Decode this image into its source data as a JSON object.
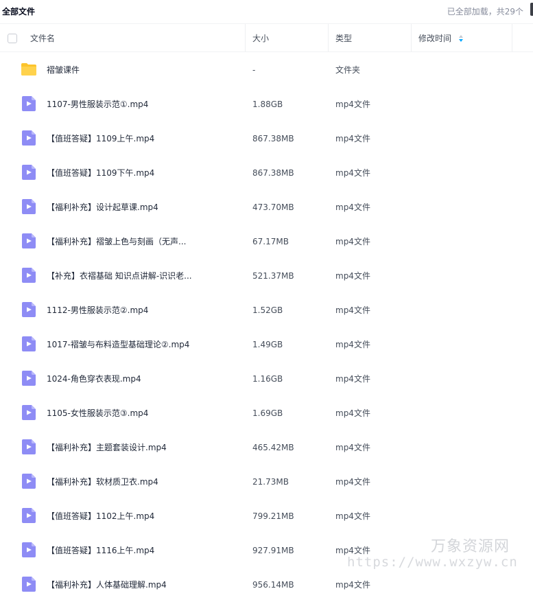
{
  "topbar": {
    "breadcrumb": "全部文件",
    "load_status": "已全部加载，共29个"
  },
  "header": {
    "name": "文件名",
    "size": "大小",
    "type": "类型",
    "modified": "修改时间"
  },
  "colors": {
    "folder": "#fcc42c",
    "video": "#8e8cf5",
    "divider": "#f1f2f4",
    "sort_active": "#06a7ff"
  },
  "files": [
    {
      "name": "褶皱课件",
      "size": "-",
      "type": "文件夹",
      "icon": "folder-icon"
    },
    {
      "name": "1107-男性服装示范①.mp4",
      "size": "1.88GB",
      "type": "mp4文件",
      "icon": "video-icon"
    },
    {
      "name": "【值班答疑】1109上午.mp4",
      "size": "867.38MB",
      "type": "mp4文件",
      "icon": "video-icon"
    },
    {
      "name": "【值班答疑】1109下午.mp4",
      "size": "867.38MB",
      "type": "mp4文件",
      "icon": "video-icon"
    },
    {
      "name": "【福利补充】设计起草课.mp4",
      "size": "473.70MB",
      "type": "mp4文件",
      "icon": "video-icon"
    },
    {
      "name": "【福利补充】褶皱上色与刻画（无声...",
      "size": "67.17MB",
      "type": "mp4文件",
      "icon": "video-icon"
    },
    {
      "name": "【补充】衣褶基础 知识点讲解-识识老...",
      "size": "521.37MB",
      "type": "mp4文件",
      "icon": "video-icon"
    },
    {
      "name": "1112-男性服装示范②.mp4",
      "size": "1.52GB",
      "type": "mp4文件",
      "icon": "video-icon"
    },
    {
      "name": "1017-褶皱与布料造型基础理论②.mp4",
      "size": "1.49GB",
      "type": "mp4文件",
      "icon": "video-icon"
    },
    {
      "name": "1024-角色穿衣表现.mp4",
      "size": "1.16GB",
      "type": "mp4文件",
      "icon": "video-icon"
    },
    {
      "name": "1105-女性服装示范③.mp4",
      "size": "1.69GB",
      "type": "mp4文件",
      "icon": "video-icon"
    },
    {
      "name": "【福利补充】主题套装设计.mp4",
      "size": "465.42MB",
      "type": "mp4文件",
      "icon": "video-icon"
    },
    {
      "name": "【福利补充】软材质卫衣.mp4",
      "size": "21.73MB",
      "type": "mp4文件",
      "icon": "video-icon"
    },
    {
      "name": "【值班答疑】1102上午.mp4",
      "size": "799.21MB",
      "type": "mp4文件",
      "icon": "video-icon"
    },
    {
      "name": "【值班答疑】1116上午.mp4",
      "size": "927.91MB",
      "type": "mp4文件",
      "icon": "video-icon"
    },
    {
      "name": "【福利补充】人体基础理解.mp4",
      "size": "956.14MB",
      "type": "mp4文件",
      "icon": "video-icon"
    }
  ],
  "watermark": {
    "cn": "万象资源网",
    "en": "https://www.wxzyw.cn"
  }
}
